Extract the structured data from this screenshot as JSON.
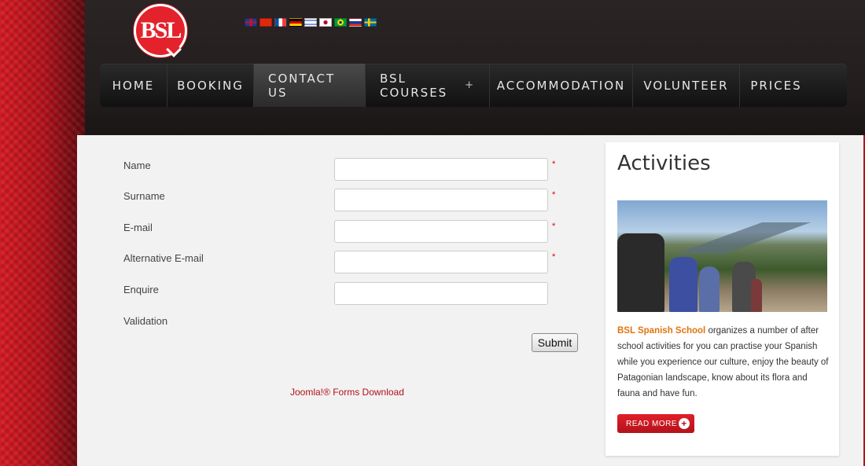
{
  "brand": {
    "logo_text": "BSL"
  },
  "languages": [
    "uk-flag",
    "cn-flag",
    "fr-flag",
    "de-flag",
    "il-flag",
    "jp-flag",
    "br-flag",
    "ru-flag",
    "se-flag"
  ],
  "nav": {
    "items": [
      {
        "label": "HOME"
      },
      {
        "label": "BOOKING"
      },
      {
        "label": "CONTACT US",
        "active": true
      },
      {
        "label": "BSL COURSES",
        "has_submenu": true
      },
      {
        "label": "ACCOMMODATION"
      },
      {
        "label": "VOLUNTEER"
      },
      {
        "label": "PRICES"
      }
    ],
    "submenu_glyph": "+"
  },
  "form": {
    "fields": [
      {
        "label": "Name",
        "value": "",
        "required": true
      },
      {
        "label": "Surname",
        "value": "",
        "required": true
      },
      {
        "label": "E-mail",
        "value": "",
        "required": true
      },
      {
        "label": "Alternative E-mail",
        "value": "",
        "required": true
      },
      {
        "label": "Enquire",
        "value": "",
        "required": false
      }
    ],
    "validation_label": "Validation",
    "required_mark": "*",
    "submit_label": "Submit",
    "footer_link": "Joomla!® Forms Download"
  },
  "sidebar": {
    "title": "Activities",
    "text_brand": "BSL Spanish School",
    "text_body": " organizes a number of after school activities for you can practise your Spanish while you experience our culture, enjoy the beauty of Patagonian landscape, know about its flora and fauna and have fun.",
    "read_more_label": "READ MORE",
    "read_more_icon": "+"
  },
  "colors": {
    "accent_red": "#b5121b",
    "brand_orange": "#e0740f",
    "nav_bg": "#111111"
  }
}
